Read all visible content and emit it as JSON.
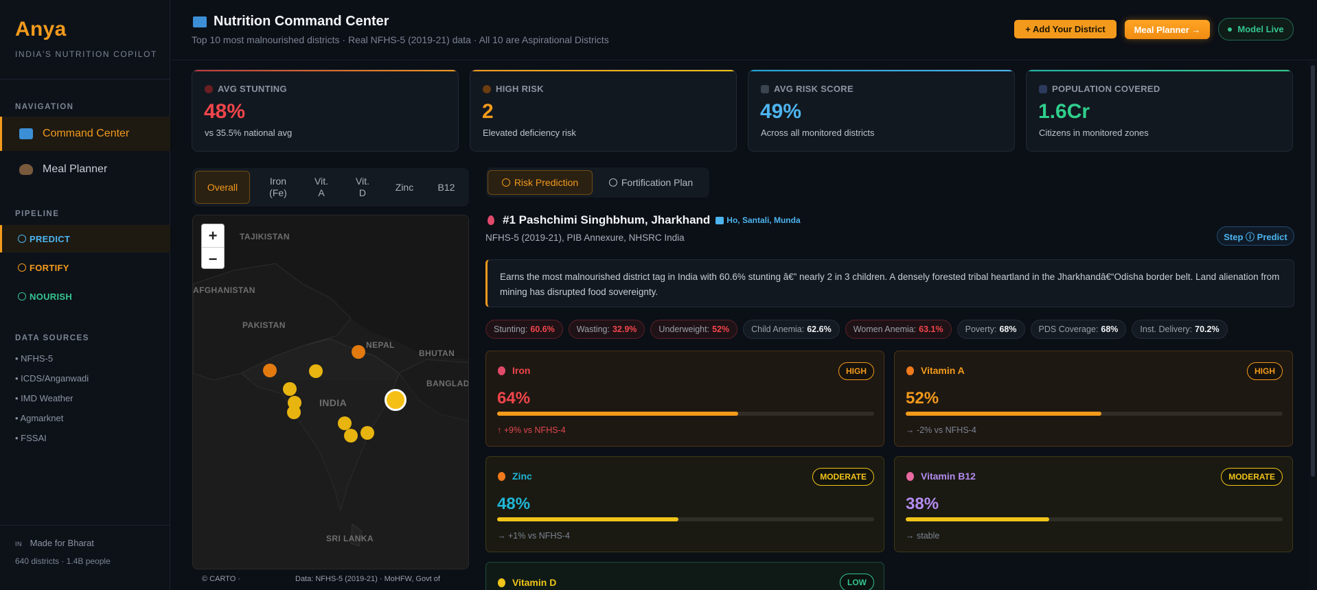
{
  "sidebar": {
    "brand": "Anya",
    "brand_sub": "INDIA'S NUTRITION COPILOT",
    "nav_heading": "NAVIGATION",
    "nav": [
      {
        "label": "Command Center",
        "icon": "map-icon",
        "active": true
      },
      {
        "label": "Meal Planner",
        "icon": "bowl-icon",
        "active": false
      }
    ],
    "pipeline_heading": "PIPELINE",
    "pipeline": [
      {
        "label": "PREDICT",
        "color": "#4db4ef",
        "active": true
      },
      {
        "label": "FORTIFY",
        "color": "#f39a1c",
        "active": false
      },
      {
        "label": "NOURISH",
        "color": "#35c48f",
        "active": false
      }
    ],
    "sources_heading": "DATA SOURCES",
    "sources": [
      "• NFHS-5",
      "• ICDS/Anganwadi",
      "• IMD Weather",
      "• Agmarknet",
      "• FSSAI"
    ],
    "footer_flag": "IN",
    "footer_line1": "Made for Bharat",
    "footer_line2": "640 districts · 1.4B people"
  },
  "header": {
    "title": "Nutrition Command Center",
    "subtitle": "Top 10 most malnourished districts · Real NFHS-5 (2019-21) data · All 10 are Aspirational Districts",
    "add_button": "+ Add Your District",
    "meal_button": "Meal Planner →",
    "live_button": "Model Live"
  },
  "stats": [
    {
      "label": "AVG STUNTING",
      "value": "48%",
      "note": "vs 35.5% national avg",
      "color": "#f0454b",
      "icon_color": "#6b1f23"
    },
    {
      "label": "HIGH RISK",
      "value": "2",
      "note": "Elevated deficiency risk",
      "color": "#f39a1c",
      "icon_color": "#6b3d10"
    },
    {
      "label": "AVG RISK SCORE",
      "value": "49%",
      "note": "Across all monitored districts",
      "color": "#4db4ef",
      "icon_color": "#3a4552"
    },
    {
      "label": "POPULATION COVERED",
      "value": "1.6Cr",
      "note": "Citizens in monitored zones",
      "color": "#2fcf8c",
      "icon_color": "#2c3a5c"
    }
  ],
  "nutrient_tabs": [
    "Overall",
    "Iron\n(Fe)",
    "Vit.\nA",
    "Vit.\nD",
    "Zinc",
    "B12"
  ],
  "map": {
    "labels": [
      "TAJIKISTAN",
      "AFGHANISTAN",
      "PAKISTAN",
      "NEPAL",
      "BHUTAN",
      "BANGLADESH",
      "INDIA",
      "SRI LANKA"
    ],
    "attribution_left": "© CARTO ·",
    "attribution_right": "Data: NFHS-5 (2019-21) · MoHFW, Govt of"
  },
  "right_tabs": [
    "Risk Prediction",
    "Fortification Plan"
  ],
  "district": {
    "title": "#1 Pashchimi Singhbhum, Jharkhand",
    "tribes": "Ho, Santali, Munda",
    "source": "NFHS-5 (2019-21), PIB Annexure, NHSRC India",
    "step": "Step ⓘ Predict",
    "description": "Earns the most malnourished district tag in India with 60.6% stunting â€” nearly 2 in 3 children. A densely forested tribal heartland in the Jharkhandâ€“Odisha border belt. Land alienation from mining has disrupted food sovereignty."
  },
  "chips": [
    {
      "label": "Stunting:",
      "value": "60.6%",
      "bad": true
    },
    {
      "label": "Wasting:",
      "value": "32.9%",
      "bad": true
    },
    {
      "label": "Underweight:",
      "value": "52%",
      "bad": true
    },
    {
      "label": "Child Anemia:",
      "value": "62.6%",
      "bad": false
    },
    {
      "label": "Women Anemia:",
      "value": "63.1%",
      "bad": true
    },
    {
      "label": "Poverty:",
      "value": "68%",
      "bad": false
    },
    {
      "label": "PDS Coverage:",
      "value": "68%",
      "bad": false
    },
    {
      "label": "Inst. Delivery:",
      "value": "70.2%",
      "bad": false
    }
  ],
  "nutrients": [
    {
      "name": "Iron",
      "level": "HIGH",
      "value": "64%",
      "fraction": 0.64,
      "trend": "↑ +9% vs NFHS-4",
      "trend_color": "#e0484e",
      "name_color": "#f0454b",
      "value_color": "#f0454b",
      "bar": "#f39a1c",
      "bg": "#1e1812",
      "border": "#4a3516",
      "badge_color": "#f39a1c",
      "icon": "drop-icon",
      "icon_color": "#e14a6a"
    },
    {
      "name": "Vitamin A",
      "level": "HIGH",
      "value": "52%",
      "fraction": 0.52,
      "trend": "→ -2% vs NFHS-4",
      "trend_color": "#7c8594",
      "name_color": "#f39a1c",
      "value_color": "#f39a1c",
      "bar": "#f39a1c",
      "bg": "#1e1812",
      "border": "#4a3516",
      "badge_color": "#f39a1c",
      "icon": "carrot-icon",
      "icon_color": "#f07a1c"
    },
    {
      "name": "Zinc",
      "level": "MODERATE",
      "value": "48%",
      "fraction": 0.48,
      "trend": "→ +1% vs NFHS-4",
      "trend_color": "#7c8594",
      "name_color": "#1fb6d6",
      "value_color": "#1fb6d6",
      "bar": "#f0c419",
      "bg": "#1a1a12",
      "border": "#3e3a16",
      "badge_color": "#f0c419",
      "icon": "zinc-icon",
      "icon_color": "#f07a1c"
    },
    {
      "name": "Vitamin B12",
      "level": "MODERATE",
      "value": "38%",
      "fraction": 0.38,
      "trend": "→ stable",
      "trend_color": "#7c8594",
      "name_color": "#b48cf0",
      "value_color": "#b48cf0",
      "bar": "#f0c419",
      "bg": "#1a1a12",
      "border": "#3e3a16",
      "badge_color": "#f0c419",
      "icon": "pill-icon",
      "icon_color": "#e86aa0"
    },
    {
      "name": "Vitamin D",
      "level": "LOW",
      "value": "",
      "fraction": 0,
      "trend": "",
      "trend_color": "#7c8594",
      "name_color": "#f0c419",
      "value_color": "#f0c419",
      "bar": "#35c48f",
      "bg": "#0f1a16",
      "border": "#1f4a3a",
      "badge_color": "#35c48f",
      "icon": "sun-icon",
      "icon_color": "#f0c419"
    }
  ]
}
